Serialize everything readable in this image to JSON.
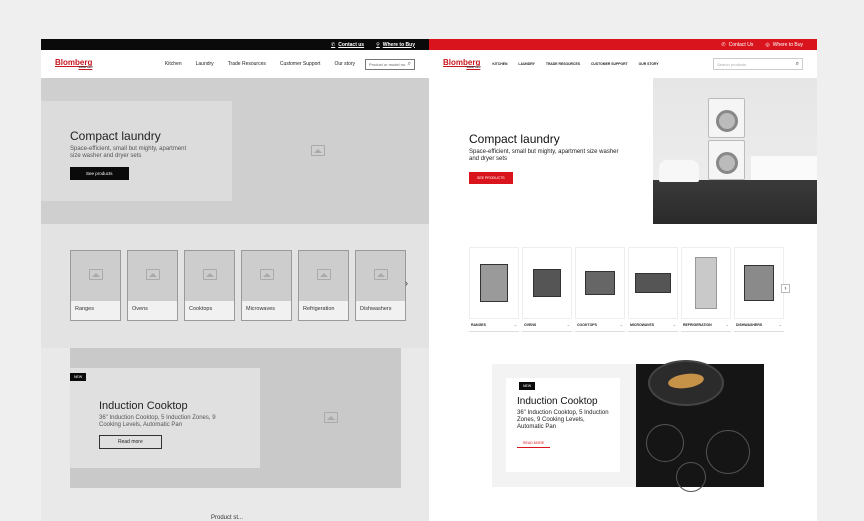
{
  "wireframe": {
    "topbar": {
      "contact": "Contact us",
      "where": "Where to Buy"
    },
    "logo": "Blomberg",
    "logo_sub": "SINCE 1883",
    "nav": [
      "Kitchen",
      "Laundry",
      "Trade Resources",
      "Customer Support",
      "Our story"
    ],
    "search_placeholder": "Product or model no.",
    "hero": {
      "title": "Compact laundry",
      "subtitle": "Space-efficient, small but mighty, apartment size washer and dryer sets",
      "button": "See products"
    },
    "categories": [
      "Ranges",
      "Ovens",
      "Cooktops",
      "Microwaves",
      "Refrigeration",
      "Dishwashers"
    ],
    "promo": {
      "tag": "NEW",
      "title": "Induction Cooktop",
      "text": "36\" Induction Cooktop, 5 Induction Zones, 9 Cooking Levels, Automatic Pan",
      "button": "Read more"
    },
    "more_heading": "Product st..."
  },
  "design": {
    "topbar": {
      "contact": "Contact Us",
      "where": "Where to Buy"
    },
    "logo": "Blomberg",
    "logo_sub": "SINCE 1883",
    "nav": [
      "Kitchen",
      "Laundry",
      "Trade Resources",
      "Customer Support",
      "Our Story"
    ],
    "search_placeholder": "Search products",
    "hero": {
      "title": "Compact laundry",
      "subtitle": "Space-efficient, small but mighty, apartment size washer and dryer sets",
      "button": "SEE PRODUCTS"
    },
    "categories": [
      "Ranges",
      "Ovens",
      "Cooktops",
      "Microwaves",
      "Refrigeration",
      "Dishwashers"
    ],
    "promo": {
      "tag": "NEW",
      "title": "Induction Cooktop",
      "text": "36\" Induction Cooktop, 5 Induction Zones, 9 Cooking Levels, Automatic Pan",
      "button": "READ MORE"
    }
  },
  "colors": {
    "brand_red": "#d9141d",
    "black": "#0a0a0a"
  }
}
